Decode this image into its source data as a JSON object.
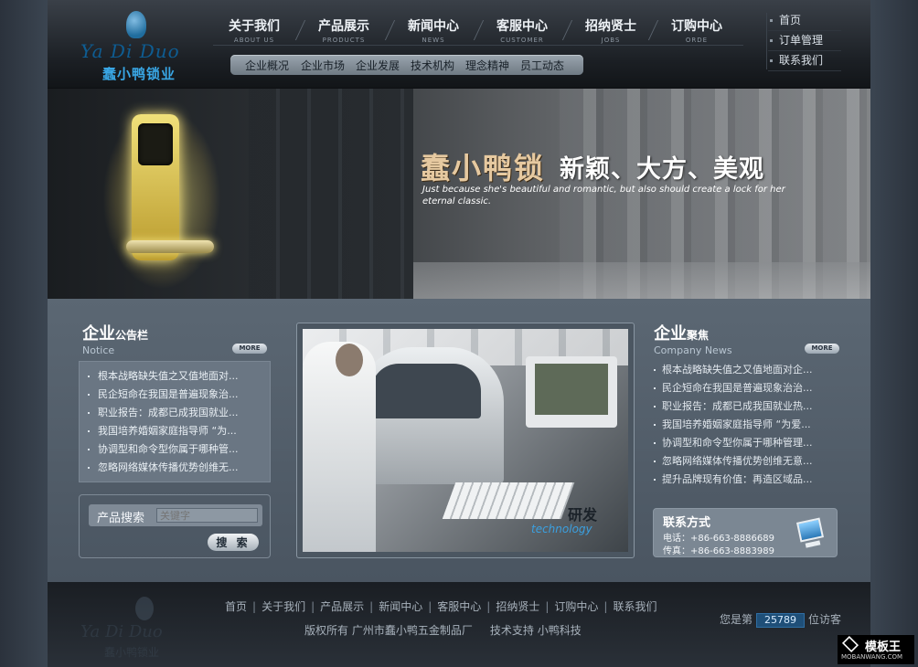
{
  "logo": {
    "en": "Ya Di Duo",
    "cn": "蠢小鸭锁业"
  },
  "nav": [
    {
      "cn": "关于我们",
      "en": "ABOUT US"
    },
    {
      "cn": "产品展示",
      "en": "PRODUCTS"
    },
    {
      "cn": "新闻中心",
      "en": "NEWS"
    },
    {
      "cn": "客服中心",
      "en": "CUSTOMER"
    },
    {
      "cn": "招纳贤士",
      "en": "JOBS"
    },
    {
      "cn": "订购中心",
      "en": "ORDE"
    }
  ],
  "subnav": [
    "企业概况",
    "企业市场",
    "企业发展",
    "技术机构",
    "理念精神",
    "员工动态"
  ],
  "quick": [
    "首页",
    "订单管理",
    "联系我们"
  ],
  "banner": {
    "slogan": "蠢小鸭锁",
    "slogan2": "新颖、大方、美观",
    "tagline": "Just because she's beautiful and romantic, but also should create a lock for her eternal classic."
  },
  "notice": {
    "title_big": "企业",
    "title_small": "公告栏",
    "title_en": "Notice",
    "more": "MORE",
    "items": [
      "根本战略缺失值之又值地面对...",
      "民企短命在我国是普遍现象治...",
      "职业报告：成都已成我国就业...",
      "我国培养婚姻家庭指导师 “为...",
      "协调型和命令型你属于哪种管...",
      "忽略网络媒体传播优势创维无..."
    ]
  },
  "search": {
    "label": "产品搜索",
    "placeholder": "关键字",
    "button": "搜 索"
  },
  "photo": {
    "label": "研发",
    "label_en": "technology"
  },
  "company_news": {
    "title_big": "企业",
    "title_small": "聚焦",
    "title_en": "Company News",
    "more": "MORE",
    "items": [
      "根本战略缺失值之又值地面对企...",
      "民企短命在我国是普遍现象治治...",
      "职业报告：成都已成我国就业热...",
      "我国培养婚姻家庭指导师 “为爱...",
      "协调型和命令型你属于哪种管理...",
      "忽略网络媒体传播优势创维无意...",
      "提升品牌现有价值：再造区域品..."
    ]
  },
  "contact": {
    "title": "联系方式",
    "phone": "电话：+86-663-8886689",
    "fax": "传真：+86-663-8883989"
  },
  "footer": {
    "links": [
      "首页",
      "关于我们",
      "产品展示",
      "新闻中心",
      "客服中心",
      "招纳贤士",
      "订购中心",
      "联系我们"
    ],
    "copyright": "版权所有  广州市蠢小鸭五金制品厂",
    "support": "技术支持  小鸭科技",
    "visit_prefix": "您是第",
    "visit_count": "25789",
    "visit_suffix": "位访客"
  },
  "watermark": {
    "title": "模板王",
    "site": "MOBANWANG.COM"
  },
  "colors": {
    "accent": "#39a7e6",
    "counter_bg": "#1f4f78",
    "panel": "#6a7683"
  }
}
